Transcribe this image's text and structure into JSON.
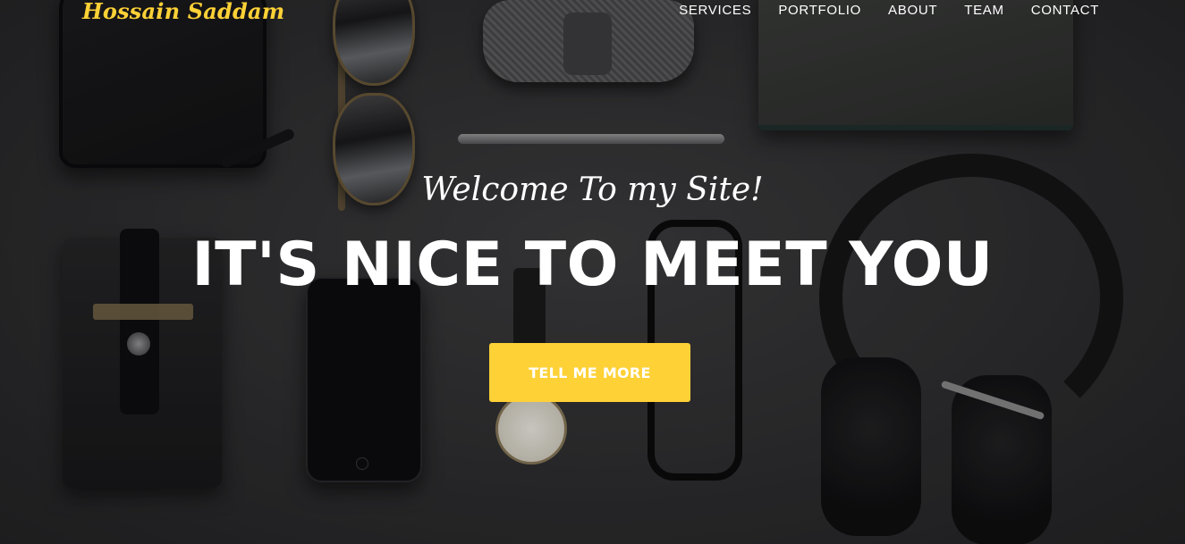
{
  "brand": {
    "name": "Hossain Saddam"
  },
  "nav": {
    "items": [
      {
        "label": "SERVICES"
      },
      {
        "label": "PORTFOLIO"
      },
      {
        "label": "ABOUT"
      },
      {
        "label": "TEAM"
      },
      {
        "label": "CONTACT"
      }
    ]
  },
  "hero": {
    "subheading": "Welcome To my Site!",
    "heading": "IT'S NICE TO MEET YOU",
    "button_label": "TELL ME MORE",
    "background_image": "dark flat-lay of accessories: wallet, sunglasses, bow tie, pen, notebook, headphones, phone sleeve, phone, wristwatch, eyeglasses"
  },
  "colors": {
    "accent": "#fed136",
    "text": "#ffffff",
    "background": "#2f2f31"
  }
}
